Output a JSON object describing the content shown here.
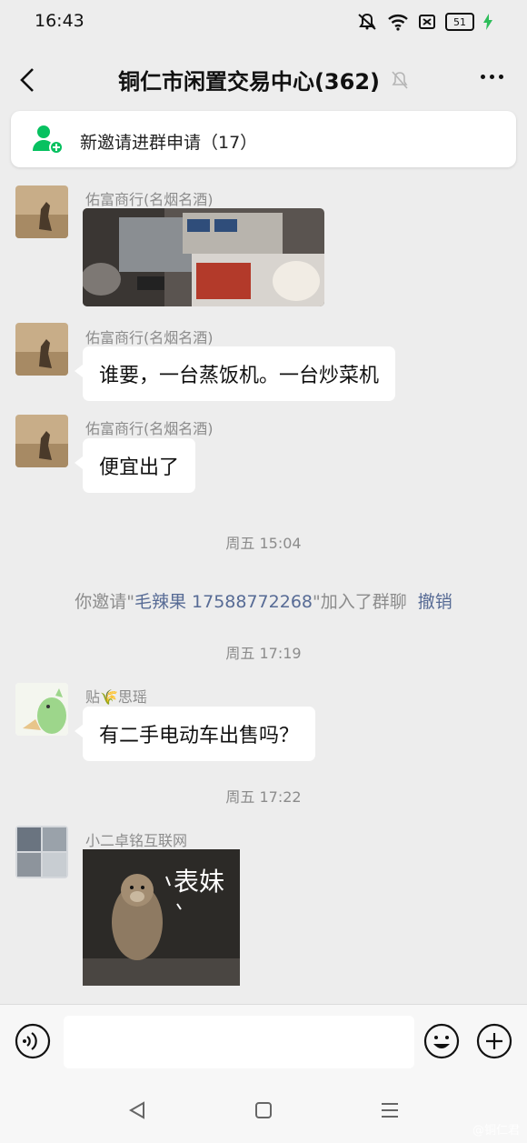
{
  "status": {
    "time": "16:43",
    "battery": "51"
  },
  "header": {
    "title": "铜仁市闲置交易中心(362)"
  },
  "invite_banner": {
    "text": "新邀请进群申请（17）"
  },
  "messages": {
    "m1": {
      "sender": "佑富商行(名烟名酒)"
    },
    "m2": {
      "sender": "佑富商行(名烟名酒)",
      "text": "谁要，一台蒸饭机。一台炒菜机"
    },
    "m3": {
      "sender": "佑富商行(名烟名酒)",
      "text": "便宜出了"
    },
    "t1": "周五 15:04",
    "sys": {
      "prefix": "你邀请\"",
      "name": "毛辣果 17588772268",
      "suffix": "\"加入了群聊",
      "revoke": "撤销"
    },
    "t2": "周五 17:19",
    "m4": {
      "sender": "贴🌾思瑶",
      "text": "有二手电动车出售吗？"
    },
    "t3": "周五 17:22",
    "m5": {
      "sender": "小二卓铭互联网",
      "sticker_text": "表妹"
    }
  },
  "watermark": "@铜仁君",
  "colors": {
    "bg": "#ededed",
    "link": "#576b95",
    "green": "#07c160"
  }
}
